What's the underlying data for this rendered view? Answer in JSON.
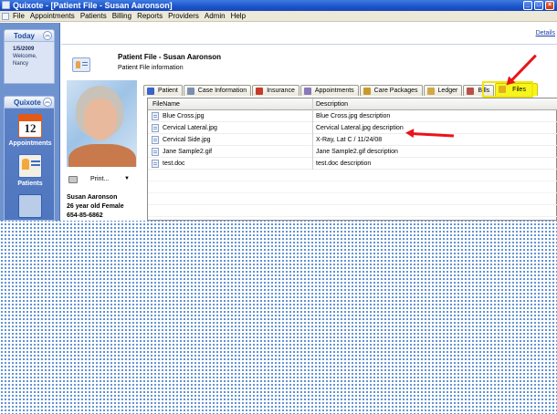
{
  "window": {
    "title": "Quixote - [Patient File - Susan Aaronson]",
    "buttons": [
      "_",
      "□",
      "×"
    ]
  },
  "menu": {
    "items": [
      "File",
      "Appointments",
      "Patients",
      "Billing",
      "Reports",
      "Providers",
      "Admin",
      "Help"
    ]
  },
  "today_panel": {
    "title": "Today",
    "date": "1/5/2009",
    "welcome": "Welcome,",
    "user": "Nancy"
  },
  "quixote_panel": {
    "title": "Quixote",
    "calendar_number": "12",
    "buttons": [
      {
        "label": "Appointments",
        "icon": "calendar-icon"
      },
      {
        "label": "Patients",
        "icon": "patient-card-icon"
      },
      {
        "label": "",
        "icon": "bills-icon"
      }
    ]
  },
  "header": {
    "details_link": "Details",
    "title": "Patient File - Susan Aaronson",
    "subtitle": "Patient File information"
  },
  "patient": {
    "print_label": "Print...",
    "name": "Susan Aaronson",
    "age_sex": "26 year old Female",
    "phone": "654-85-6862"
  },
  "tabs": [
    {
      "label": "Patient",
      "icon_color": "#3a64c8"
    },
    {
      "label": "Case Information",
      "icon_color": "#7a8fb0"
    },
    {
      "label": "Insurance",
      "icon_color": "#c83a2a"
    },
    {
      "label": "Appointments",
      "icon_color": "#8a78b8"
    },
    {
      "label": "Care Packages",
      "icon_color": "#c89a2a"
    },
    {
      "label": "Ledger",
      "icon_color": "#d0a848"
    },
    {
      "label": "Bills",
      "icon_color": "#b8504a"
    },
    {
      "label": "Files",
      "icon_color": "#e0b020",
      "active": true
    }
  ],
  "files_grid": {
    "headers": [
      "FileName",
      "Description"
    ],
    "rows": [
      {
        "filename": "Blue Cross.jpg",
        "description": "Blue Cross.jpg description"
      },
      {
        "filename": "Cervical Lateral.jpg",
        "description": "Cervical Lateral.jpg description"
      },
      {
        "filename": "Cervical Side.jpg",
        "description": "X-Ray, Lat C / 11/24/08"
      },
      {
        "filename": "Jane Sample2.gif",
        "description": "Jane Sample2.gif description"
      },
      {
        "filename": "test.doc",
        "description": "test.doc description"
      }
    ]
  },
  "colors": {
    "title_bar": "#1c54cc",
    "nav_blue": "#6f93cf",
    "highlight_yellow": "#f6f61c",
    "arrow_red": "#e8141a"
  }
}
